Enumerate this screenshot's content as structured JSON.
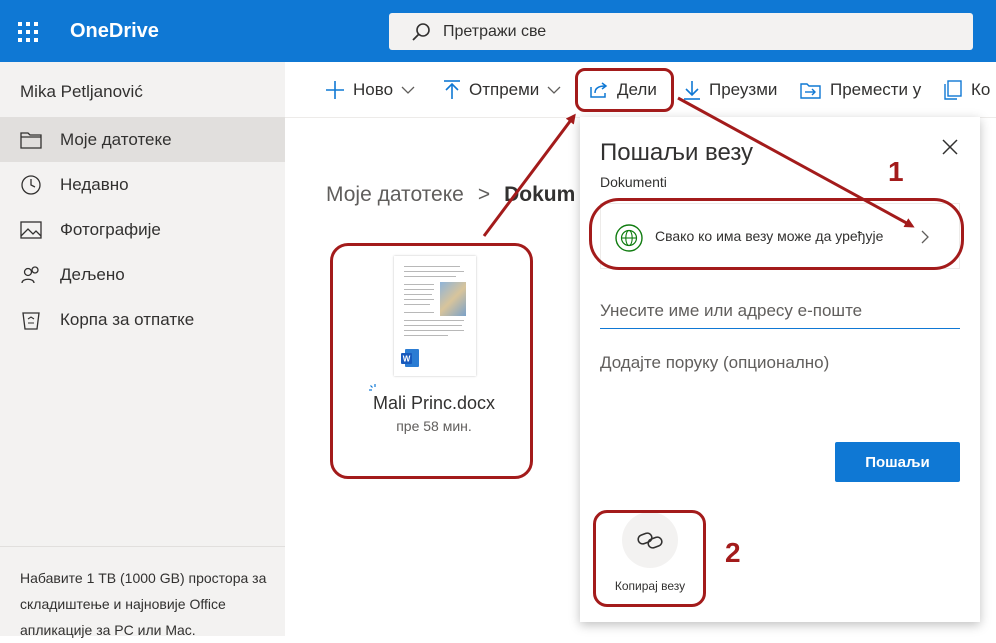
{
  "app": {
    "brand": "OneDrive"
  },
  "search": {
    "placeholder": "Претражи све"
  },
  "sidebar": {
    "user_name": "Mika Petljanović",
    "items": [
      {
        "label": "Моје датотеке",
        "icon": "folder-icon",
        "active": true
      },
      {
        "label": "Недавно",
        "icon": "clock-icon"
      },
      {
        "label": "Фотографије",
        "icon": "image-icon"
      },
      {
        "label": "Дељено",
        "icon": "people-icon"
      },
      {
        "label": "Корпа за отпатке",
        "icon": "recycle-bin-icon"
      }
    ],
    "promo": "Набавите 1 TB (1000 GB) простора за складиштење и најновије Office апликације за PC или Mac."
  },
  "toolbar": {
    "new_label": "Ново",
    "upload_label": "Отпреми",
    "share_label": "Дели",
    "download_label": "Преузми",
    "move_label": "Премести у",
    "copy_label": "Ко"
  },
  "breadcrumb": {
    "root": "Моје датотеке",
    "separator": ">",
    "current": "Dokum"
  },
  "file": {
    "name": "Mali Princ.docx",
    "modified": "пре 58 мин.",
    "type_icon": "word-icon"
  },
  "share_dialog": {
    "title": "Пошаљи везу",
    "subtitle": "Dokumenti",
    "permission": "Свако ко има везу може да уређује",
    "email_placeholder": "Унесите име или адресу е-поште",
    "message_placeholder": "Додајте поруку (опционално)",
    "send_label": "Пошаљи",
    "copy_link_label": "Копирај везу"
  },
  "annotations": {
    "step1": "1",
    "step2": "2"
  },
  "colors": {
    "brand": "#0f78d4",
    "annotation": "#a31b1b",
    "sidebar_bg": "#f3f2f1"
  }
}
